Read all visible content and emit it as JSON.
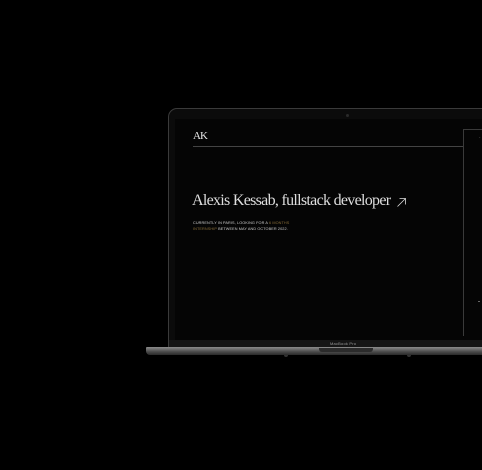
{
  "site": {
    "logo": "AK",
    "headline": "Alexis Kessab, fullstack developer",
    "subtext_part1": "Currently in Paris, looking for a ",
    "subtext_highlight": "6 months internship",
    "subtext_part2": " between May and October 2022."
  },
  "device": {
    "model_label": "MacBook Pro"
  },
  "colors": {
    "background": "#000000",
    "highlight": "#8a6f3a",
    "text": "#dedede"
  },
  "icons": {
    "headline_arrow": "arrow-up-right-icon"
  }
}
